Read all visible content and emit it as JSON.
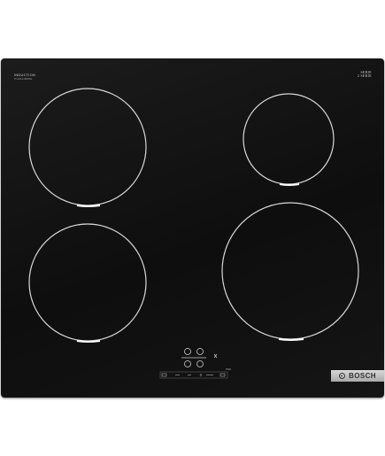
{
  "product": {
    "type_label": "INDUCTION",
    "sub_label": "PUE611BB5E",
    "serie_line1": "SERIE",
    "serie_line2": "2 SERIE",
    "serie_small": "",
    "brand": "BOSCH"
  },
  "controls": {
    "power_boost_label": "PWR",
    "timer_label": "min",
    "plus_minus": "+/-"
  },
  "zones": [
    {
      "name": "front-left-zone"
    },
    {
      "name": "rear-left-zone"
    },
    {
      "name": "rear-right-zone"
    },
    {
      "name": "front-right-zone"
    }
  ],
  "colors": {
    "glass": "#121212",
    "ring": "#d9d9d9",
    "logo_bg": "#b8b8b8"
  }
}
